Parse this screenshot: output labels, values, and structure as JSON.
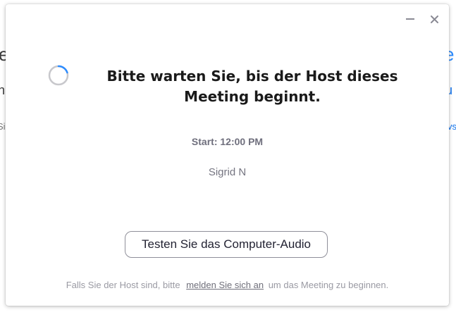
{
  "window": {
    "minimize_icon": "minus-icon",
    "close_icon": "close-icon"
  },
  "main": {
    "spinner_icon": "loading-spinner-icon",
    "title": "Bitte warten Sie, bis der Host dieses Meeting beginnt.",
    "start_time": "Start: 12:00 PM",
    "host_name": "Sigrid N",
    "audio_button_label": "Testen Sie das Computer-Audio"
  },
  "footer": {
    "text_before": "Falls Sie der Host sind, bitte",
    "link_label": "melden Sie sich an",
    "text_after": "um das Meeting zu beginnen."
  },
  "background_peek": {
    "left_chars": [
      "e",
      "n",
      "Si"
    ],
    "right_chars": [
      "e",
      "u",
      "vs"
    ]
  },
  "colors": {
    "spinner_track": "#c8c8cc",
    "spinner_accent": "#2d8cff",
    "link_blue": "#0e72ed"
  }
}
